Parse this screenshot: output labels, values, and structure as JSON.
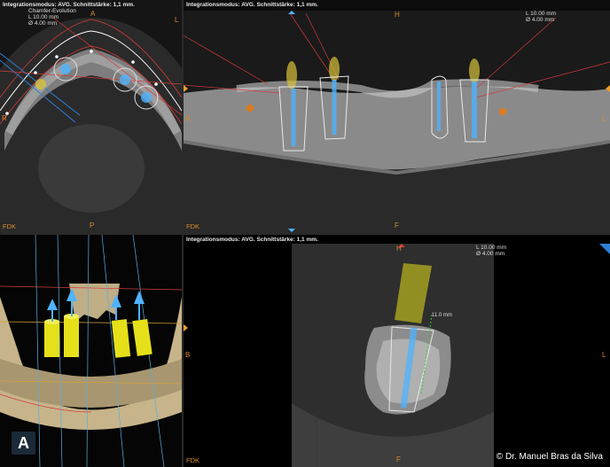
{
  "header_text": "Integrationsmodus: AVG. Schnittstärke: 1,1 mm.",
  "axial": {
    "info_line1": "Chamfer-Evolution",
    "info_line2": "L 10.00 mm",
    "info_line3": "Ø 4.00 mm",
    "top_label": "A",
    "bottom_label": "P",
    "left_label": "R",
    "right_label": "L",
    "fdk": "FDK"
  },
  "panoramic": {
    "info_line1": "L 10.00 mm",
    "info_line2": "Ø 4.00 mm",
    "top_label": "H",
    "bottom_label": "F",
    "left_label": "R",
    "right_label": "L",
    "fdk": "FDK"
  },
  "cross_section": {
    "info_line1": "L 10.00 mm",
    "info_line2": "Ø 4.00 mm",
    "top_label": "H",
    "bottom_label": "F",
    "left_label": "B",
    "right_label": "L",
    "measurement": "11.0 mm",
    "fdk": "FDK"
  },
  "view3d": {
    "badge": "A"
  },
  "copyright": "© Dr. Manuel Bras da Silva",
  "colors": {
    "orientation_label": "#d98a2a",
    "implant_blue": "#4fb3ff",
    "abutment_yellow": "#e6e01a",
    "guide_red": "#d23a3a"
  }
}
